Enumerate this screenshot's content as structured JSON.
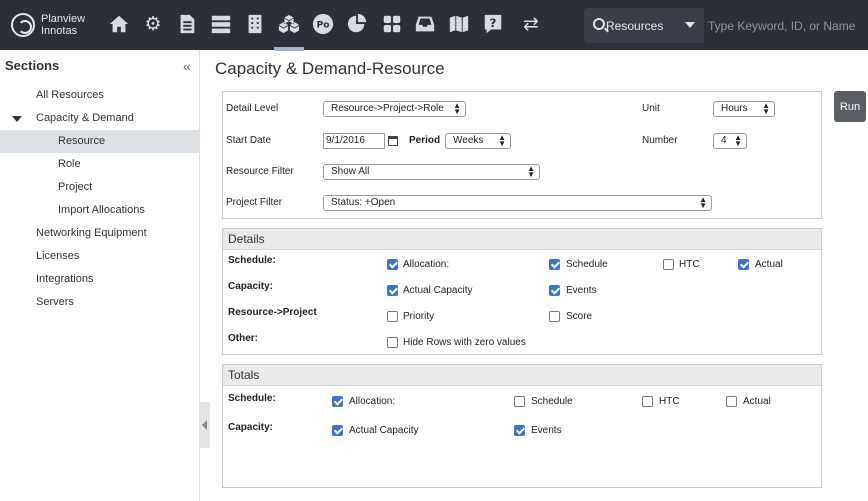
{
  "app": {
    "logo_line1": "Planview",
    "logo_line2": "Innotas"
  },
  "search": {
    "type": "Resources",
    "placeholder": "Type Keyword, ID, or Name"
  },
  "sidebar": {
    "title": "Sections",
    "items": [
      {
        "label": "All Resources"
      },
      {
        "label": "Capacity & Demand"
      },
      {
        "label": "Resource"
      },
      {
        "label": "Role"
      },
      {
        "label": "Project"
      },
      {
        "label": "Import Allocations"
      },
      {
        "label": "Networking Equipment"
      },
      {
        "label": "Licenses"
      },
      {
        "label": "Integrations"
      },
      {
        "label": "Servers"
      }
    ]
  },
  "page": {
    "title": "Capacity & Demand-Resource",
    "run_label": "Run"
  },
  "filters": {
    "detail_level_label": "Detail Level",
    "detail_level_value": "Resource->Project->Role",
    "unit_label": "Unit",
    "unit_value": "Hours",
    "start_date_label": "Start Date",
    "start_date_value": "9/1/2016",
    "period_label": "Period",
    "period_value": "Weeks",
    "number_label": "Number",
    "number_value": "4",
    "resource_filter_label": "Resource Filter",
    "resource_filter_value": "Show All",
    "project_filter_label": "Project Filter",
    "project_filter_value": "Status: +Open"
  },
  "details": {
    "title": "Details",
    "schedule_label": "Schedule:",
    "capacity_label": "Capacity:",
    "resproj_label": "Resource->Project",
    "other_label": "Other:",
    "allocation": "Allocation:",
    "schedule": "Schedule",
    "htc": "HTC",
    "actual": "Actual",
    "actual_capacity": "Actual Capacity",
    "events": "Events",
    "priority": "Priority",
    "score": "Score",
    "hide_rows": "Hide Rows with zero values",
    "checked": {
      "allocation": true,
      "schedule": true,
      "htc": false,
      "actual": true,
      "actual_capacity": true,
      "events": true,
      "priority": false,
      "score": false,
      "hide_rows": false
    }
  },
  "totals": {
    "title": "Totals",
    "schedule_label": "Schedule:",
    "capacity_label": "Capacity:",
    "allocation": "Allocation:",
    "schedule": "Schedule",
    "htc": "HTC",
    "actual": "Actual",
    "actual_capacity": "Actual Capacity",
    "events": "Events",
    "checked": {
      "allocation": true,
      "schedule": false,
      "htc": false,
      "actual": false,
      "actual_capacity": true,
      "events": true
    }
  }
}
